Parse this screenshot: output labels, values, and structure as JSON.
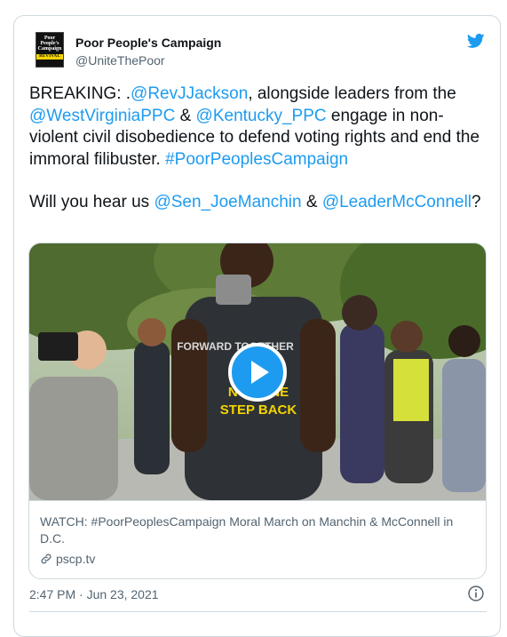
{
  "author": {
    "name": "Poor People's Campaign",
    "handle": "@UniteThePoor",
    "avatar_lines": [
      "Poor",
      "People's",
      "Campaign"
    ],
    "avatar_banner": "REVIVAL"
  },
  "tweet": {
    "p1_prefix": "BREAKING: .",
    "mention_jackson": "@RevJJackson",
    "p1_mid1": ", alongside leaders from the ",
    "mention_wv": "@WestVirginiaPPC",
    "p1_amp": " & ",
    "mention_ky": "@Kentucky_PPC",
    "p1_mid2": " engage in non-violent civil disobedience to defend voting rights and end the immoral filibuster. ",
    "hashtag": "#PoorPeoplesCampaign",
    "p2_prefix": "Will you hear us ",
    "mention_manchin": "@Sen_JoeManchin",
    "p2_amp": " & ",
    "mention_mcconnell": "@LeaderMcConnell",
    "p2_suffix": "?"
  },
  "media": {
    "card_title": "WATCH: #PoorPeoplesCampaign Moral March on Manchin & McConnell in D.C.",
    "domain": "pscp.tv",
    "shirt_text_1": "NOT ONE",
    "shirt_text_2": "STEP BACK",
    "shirt_text_0": "FORWARD TOGETHER"
  },
  "footer": {
    "timestamp": "2:47 PM · Jun 23, 2021"
  },
  "colors": {
    "link": "#1d9bf0",
    "text": "#0f1419",
    "muted": "#536471",
    "border": "#cfd9de"
  },
  "icons": {
    "brand": "twitter-bird-icon",
    "play": "play-icon",
    "link": "link-icon",
    "info": "info-icon"
  }
}
